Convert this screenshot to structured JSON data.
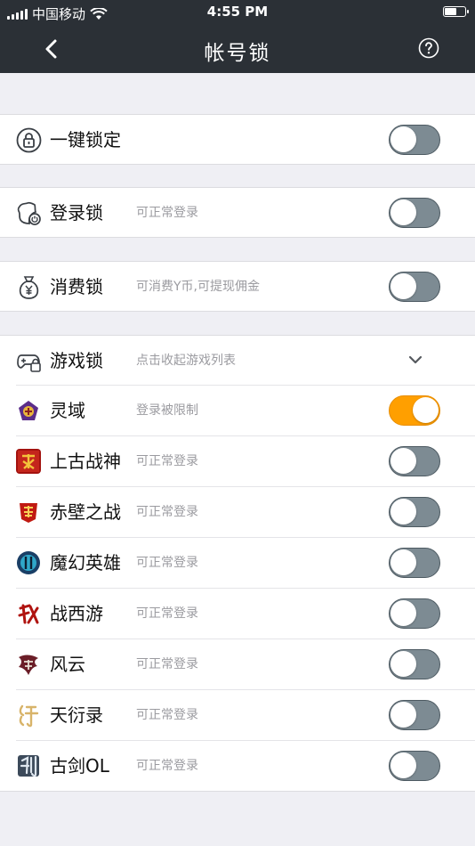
{
  "status_bar": {
    "carrier": "中国移动",
    "time": "4:55 PM"
  },
  "nav": {
    "title": "帐号锁"
  },
  "rows": {
    "onekey": {
      "label": "一键锁定"
    },
    "login": {
      "label": "登录锁",
      "sub": "可正常登录"
    },
    "spend": {
      "label": "消费锁",
      "sub": "可消费Y币,可提现佣金"
    },
    "game": {
      "label": "游戏锁",
      "sub": "点击收起游戏列表"
    }
  },
  "games": [
    {
      "name": "灵域",
      "status": "登录被限制",
      "locked": true
    },
    {
      "name": "上古战神",
      "status": "可正常登录",
      "locked": false
    },
    {
      "name": "赤壁之战",
      "status": "可正常登录",
      "locked": false
    },
    {
      "name": "魔幻英雄",
      "status": "可正常登录",
      "locked": false
    },
    {
      "name": "战西游",
      "status": "可正常登录",
      "locked": false
    },
    {
      "name": "风云",
      "status": "可正常登录",
      "locked": false
    },
    {
      "name": "天衍录",
      "status": "可正常登录",
      "locked": false
    },
    {
      "name": "古剑OL",
      "status": "可正常登录",
      "locked": false
    }
  ],
  "colors": {
    "toggle_on": "#ff9f00",
    "toggle_off": "#7d8b93",
    "header_bg": "#2b3036"
  }
}
